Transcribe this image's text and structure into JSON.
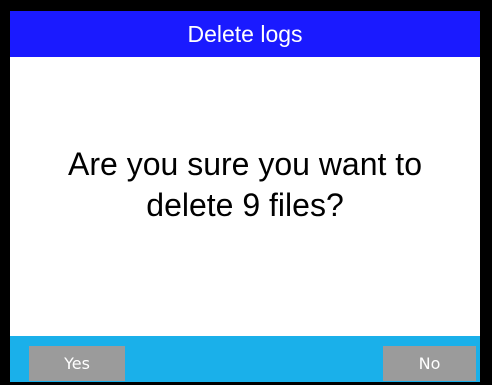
{
  "dialog": {
    "title": "Delete logs",
    "message_line1": "Are you sure you want to",
    "message_line2": "delete 9 files?",
    "yes_label": "Yes",
    "no_label": "No"
  },
  "colors": {
    "title_bar": "#1a1aff",
    "footer_bar": "#1ab0ea",
    "button": "#9b9b9b",
    "background": "#ffffff",
    "frame": "#000000"
  }
}
